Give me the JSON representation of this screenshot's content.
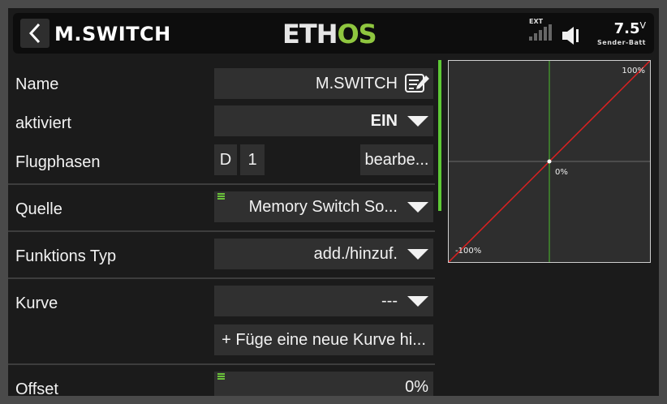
{
  "header": {
    "title": "M.SWITCH",
    "logo_part1": "ETH",
    "logo_part2": "OS",
    "ext_label": "EXT",
    "battery_value": "7.5",
    "battery_unit": "V",
    "battery_label": "Sender-Batt"
  },
  "form": {
    "name": {
      "label": "Name",
      "value": "M.SWITCH"
    },
    "enabled": {
      "label": "aktiviert",
      "value": "EIN"
    },
    "flight_modes": {
      "label": "Flugphasen",
      "mode_d": "D",
      "mode_1": "1",
      "edit_label": "bearbe..."
    },
    "source": {
      "label": "Quelle",
      "value": "Memory Switch So..."
    },
    "function_type": {
      "label": "Funktions Typ",
      "value": "add./hinzuf."
    },
    "curve": {
      "label": "Kurve",
      "value": "---",
      "add_label": "+ Füge eine neue Kurve hi..."
    },
    "offset": {
      "label": "Offset",
      "value": "0%"
    }
  },
  "graph": {
    "top_right_label": "100%",
    "center_label": "0%",
    "bottom_left_label": "-100%",
    "line_color": "#e02020",
    "axis_color": "#4bbf2b"
  },
  "colors": {
    "accent": "#8fc63f",
    "scroll": "#5ec935"
  }
}
